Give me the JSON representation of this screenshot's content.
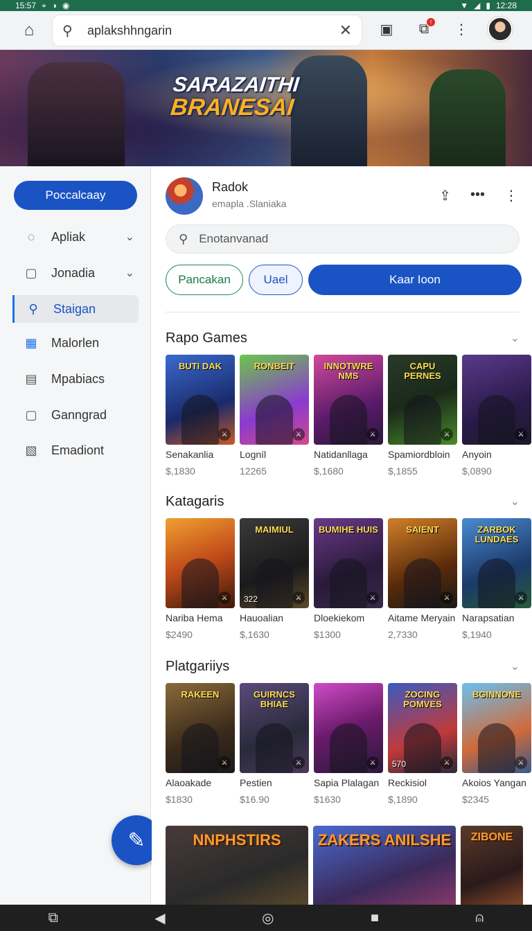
{
  "status": {
    "time": "15:57",
    "battery_time": "12:28"
  },
  "topbar": {
    "search_value": "aplakshhngarin"
  },
  "banner": {
    "line1": "SARAZAITHI",
    "line2": "BRANESAI"
  },
  "sidebar": {
    "primary_button": "Poccalcaay",
    "items": [
      {
        "label": "Apliak",
        "icon": "chat-icon",
        "has_chevron": true,
        "active": false
      },
      {
        "label": "Jonadia",
        "icon": "tray-icon",
        "has_chevron": true,
        "active": false
      },
      {
        "label": "Staigan",
        "icon": "search-icon",
        "has_chevron": false,
        "active": true
      },
      {
        "label": "Malorlen",
        "icon": "grid-icon",
        "has_chevron": false,
        "active": false
      },
      {
        "label": "Mpabiacs",
        "icon": "calendar-icon",
        "has_chevron": false,
        "active": false
      },
      {
        "label": "Ganngrad",
        "icon": "box-icon",
        "has_chevron": false,
        "active": false
      },
      {
        "label": "Emadiont",
        "icon": "chart-icon",
        "has_chevron": false,
        "active": false
      }
    ]
  },
  "app": {
    "name": "Radok",
    "subtitle": "emapla .Slaniaka"
  },
  "main_search": {
    "placeholder": "Enotanvanad"
  },
  "pills": {
    "green": "Pancakan",
    "outline": "Uael",
    "filled": "Kaar Ioon"
  },
  "sections": [
    {
      "title": "Rapo Games",
      "cards": [
        {
          "thumb_title": "BUTI DAK",
          "name": "Senakanlia",
          "price": "$,1830",
          "bg": "linear-gradient(160deg,#3a6ad0,#1a2a6a 60%,#c85a2a)"
        },
        {
          "thumb_title": "RONBEIT",
          "name": "Logníl",
          "price": "12265",
          "bg": "linear-gradient(160deg,#6ac84a,#8a3ad0 60%,#d04a8a)"
        },
        {
          "thumb_title": "INNOTWRE NMS",
          "name": "Natidanllaga",
          "price": "$,1680",
          "bg": "linear-gradient(160deg,#d04a9a,#5a1a6a 60%,#2a1a3a)"
        },
        {
          "thumb_title": "CAPU PERNES",
          "name": "Spamiordbloin",
          "price": "$,1855",
          "bg": "linear-gradient(160deg,#2a3a2a,#1a2a1a 50%,#4a8a2a)"
        },
        {
          "thumb_title": "",
          "name": "Anyoin",
          "price": "$,0890",
          "bg": "linear-gradient(160deg,#5a3a8a,#2a1a4a 60%,#1a1a2a)"
        }
      ]
    },
    {
      "title": "Katagaris",
      "cards": [
        {
          "thumb_title": "",
          "name": "Nariba Hema",
          "price": "$2490",
          "bg": "linear-gradient(160deg,#f0a030,#c04a1a 50%,#3a1a0a)"
        },
        {
          "thumb_title": "MAIMIUL",
          "name": "Hauoalian",
          "price": "$,1630",
          "bg": "linear-gradient(160deg,#3a3a3a,#1a1a1a 60%,#5a4a2a)",
          "count": "322"
        },
        {
          "thumb_title": "BUMIHE HUIS",
          "name": "Dloekiekom",
          "price": "$1300",
          "bg": "linear-gradient(160deg,#6a3a8a,#2a1a3a 60%,#3a2a4a)"
        },
        {
          "thumb_title": "SAIENT",
          "name": "Aitame Meryain",
          "price": "2,7330",
          "bg": "linear-gradient(160deg,#d0802a,#5a2a0a 60%,#1a1a1a)"
        },
        {
          "thumb_title": "ZARBOK LUNDAES",
          "name": "Narapsatian",
          "price": "$,1940",
          "bg": "linear-gradient(160deg,#4a8ad0,#1a3a6a 60%,#2a5a3a)"
        }
      ]
    },
    {
      "title": "Platgariiys",
      "cards": [
        {
          "thumb_title": "RAKEEN",
          "name": "Alaoakade",
          "price": "$1830",
          "bg": "linear-gradient(160deg,#8a6a3a,#3a2a1a 60%,#1a1a1a)"
        },
        {
          "thumb_title": "GUIRNCS BHIAE",
          "name": "Pestien",
          "price": "$16.90",
          "bg": "linear-gradient(160deg,#5a4a7a,#2a2a3a 60%,#4a3a5a)"
        },
        {
          "thumb_title": "",
          "name": "Sapia Plalagan",
          "price": "$1630",
          "bg": "linear-gradient(160deg,#d04ac8,#6a1a6a 50%,#2a1a3a)"
        },
        {
          "thumb_title": "ZOCING POMVES",
          "name": "Reckisiol",
          "price": "$,1890",
          "bg": "linear-gradient(160deg,#3a5ac0,#c03a3a 60%,#2a2a3a)",
          "count": "570"
        },
        {
          "thumb_title": "BGINNONE",
          "name": "Akoios Yangan",
          "price": "$2345",
          "bg": "linear-gradient(160deg,#6ac0f0,#d06a3a 60%,#3a5a8a)"
        }
      ]
    }
  ],
  "bottom_tiles": [
    {
      "title": "NNPHSTIRS",
      "bg": "linear-gradient(160deg,#4a3a3a,#2a2a2a 60%,#5a4a2a)"
    },
    {
      "title": "ZAKERS ANILSHE",
      "bg": "linear-gradient(160deg,#4a6ad0,#3a2a5a 60%,#8a3a6a)"
    },
    {
      "title": "ZIBONE",
      "bg": "linear-gradient(160deg,#5a3a2a,#2a1a1a 60%,#8a4a2a)"
    }
  ]
}
